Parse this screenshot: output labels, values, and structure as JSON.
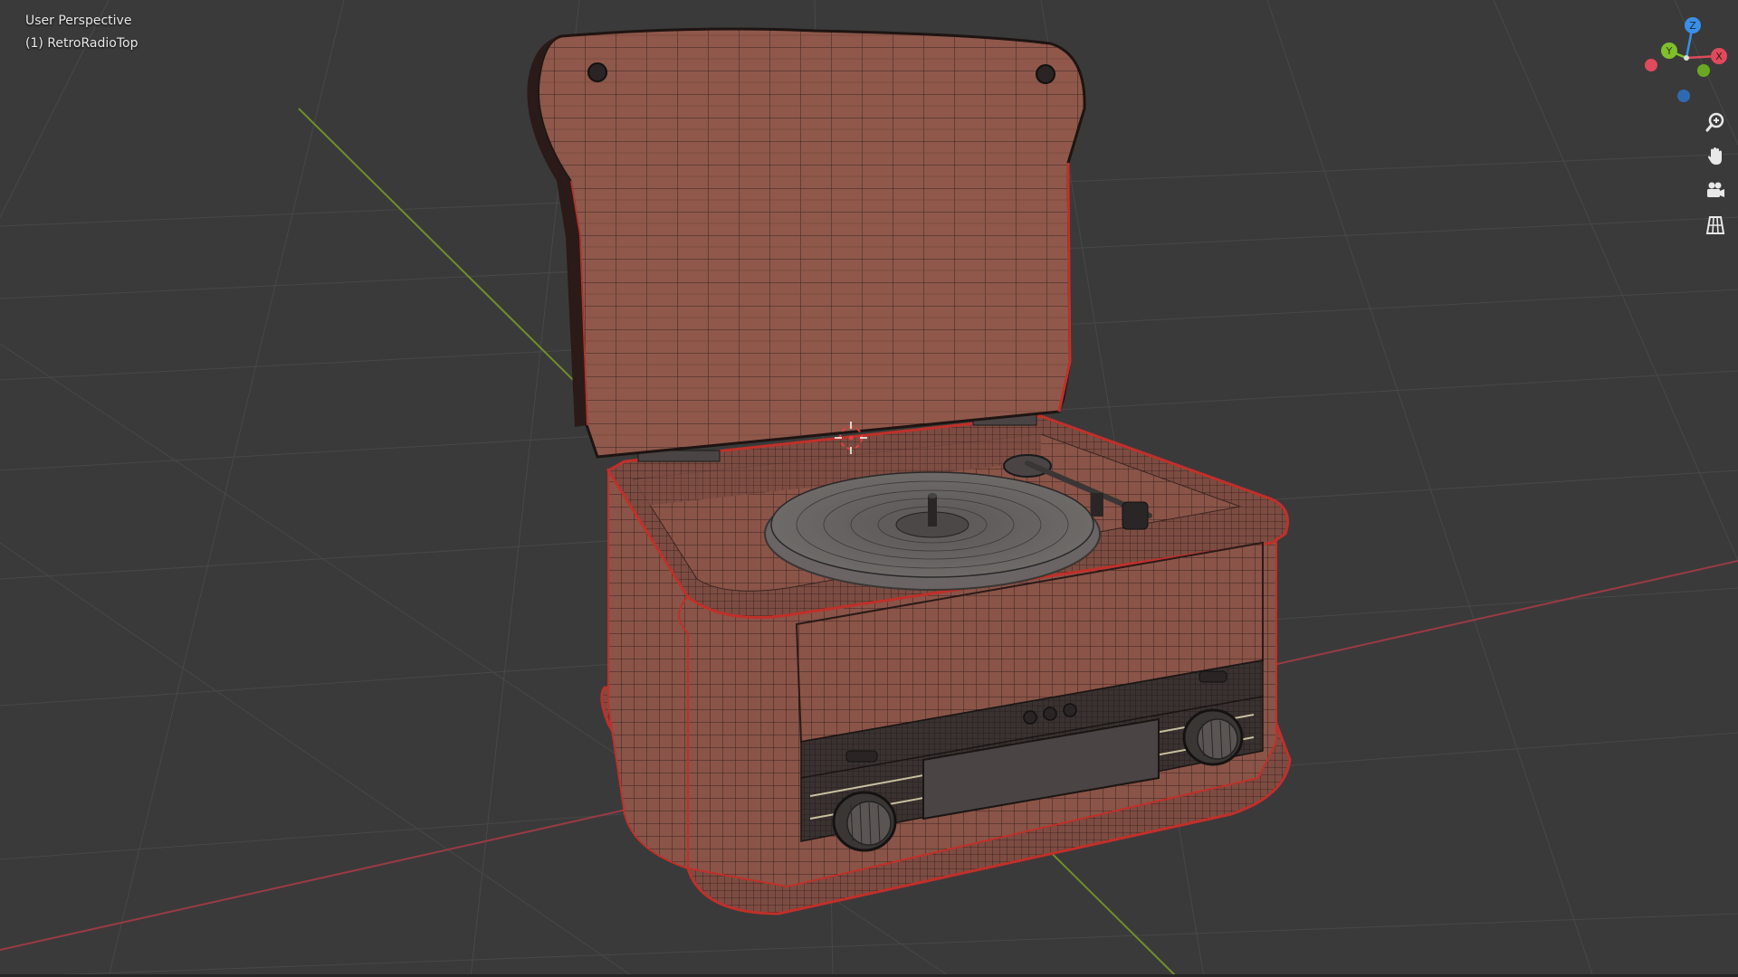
{
  "viewport": {
    "view_name": "User Perspective",
    "object_name": "(1) RetroRadioTop",
    "background_color": "#3a3a3a",
    "grid_color": "#4a4a4a",
    "x_axis_color": "#9a3a44",
    "y_axis_color": "#6f8f2a"
  },
  "gizmo": {
    "x_label": "X",
    "y_label": "Y",
    "z_label": "Z",
    "x_color": "#e04a5c",
    "y_color": "#7fc02a",
    "z_color": "#3a8fe8"
  },
  "nav_buttons": [
    {
      "name": "zoom",
      "icon": "zoom-magnifier-icon"
    },
    {
      "name": "pan",
      "icon": "hand-icon"
    },
    {
      "name": "camera",
      "icon": "camera-icon"
    },
    {
      "name": "orthographic",
      "icon": "grid-perspective-icon"
    }
  ],
  "model": {
    "name": "RetroRadioTop",
    "wood_color": "#8a5448",
    "wire_color": "#2a1a18",
    "edge_highlight_color": "#c0302a"
  }
}
